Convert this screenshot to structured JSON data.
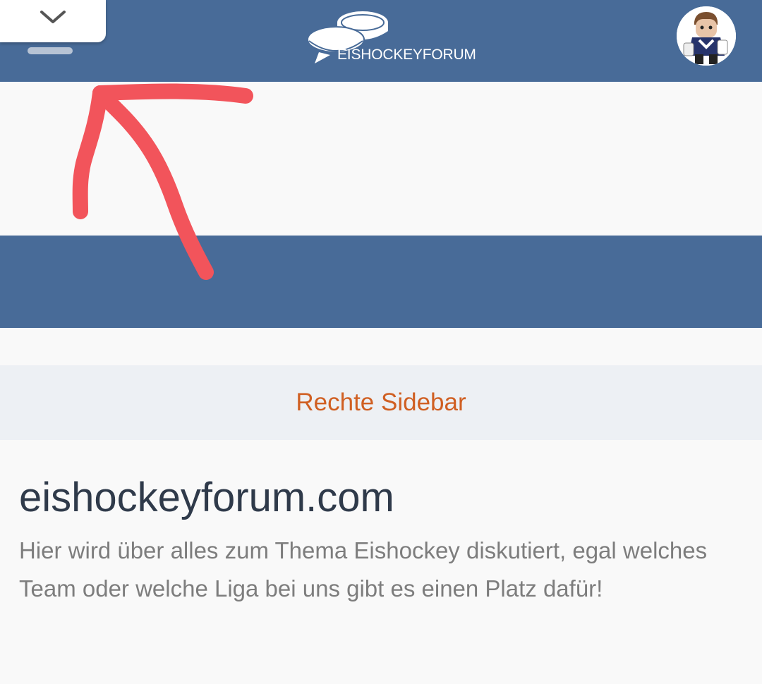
{
  "header": {
    "logo_text": "EISHOCKEYFORUM",
    "collapse_icon": "chevron-down-icon",
    "avatar_icon": "user-avatar-hockey-figure",
    "background_color": "#486b98"
  },
  "sidebar_toggle": {
    "label": "Rechte Sidebar",
    "color": "#d05f22"
  },
  "site_info": {
    "title": "eishockeyforum.com",
    "description": "Hier wird über alles zum Thema Eishockey diskutiert, egal welches Team oder welche Liga bei uns gibt es einen Platz dafür!"
  },
  "annotation": {
    "type": "hand-drawn-arrow",
    "color": "#f2545b"
  }
}
